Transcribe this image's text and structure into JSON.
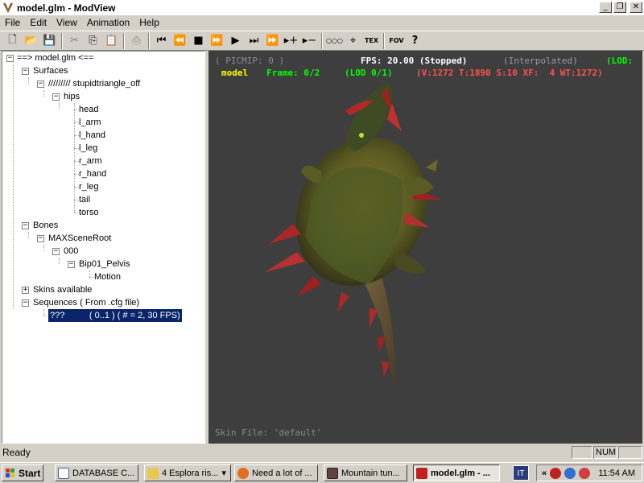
{
  "window": {
    "title": "model.glm - ModView",
    "min_glyph": "_",
    "max_glyph": "❐",
    "close_glyph": "✕"
  },
  "menu": [
    "File",
    "Edit",
    "View",
    "Animation",
    "Help"
  ],
  "toolbar": {
    "icons": [
      "new-file-icon",
      "open-folder-icon",
      "save-icon",
      "cut-icon",
      "copy-icon",
      "paste-icon",
      "print-icon",
      "rewind-icon",
      "step-back-icon",
      "stop-icon",
      "step-forward-icon",
      "play-icon",
      "play-end-icon",
      "fast-forward-icon",
      "add-icon",
      "remove-icon",
      "bones-icon",
      "fit-icon",
      "texture-icon",
      "fov-icon",
      "help-icon"
    ],
    "fov_label": "FOV",
    "tex_label": "TEX",
    "help_label": "?"
  },
  "tree": {
    "root": "==> model.glm <==",
    "surfaces": "Surfaces",
    "surface_root": "///////// stupidtriangle_off",
    "hips": "hips",
    "parts": [
      "head",
      "l_arm",
      "l_hand",
      "l_leg",
      "r_arm",
      "r_hand",
      "r_leg",
      "tail",
      "torso"
    ],
    "bones": "Bones",
    "max_root": "MAXSceneRoot",
    "bone_000": "000",
    "pelvis": "Bip01_Pelvis",
    "motion": "Motion",
    "skins": "Skins available",
    "sequences": "Sequences ( From .cfg file)",
    "sequence_item": "???          ( 0..1 ) ( # = 2, 30 FPS)"
  },
  "viewport": {
    "picmip": "( PICMIP: 0 )",
    "fps": "FPS: 20.00 (Stopped)",
    "interp": "(Interpolated)",
    "lod_top": "(LOD:",
    "model_label": "model",
    "frame": "Frame: 0/2",
    "lod": "(LOD 0/1)",
    "stats": "(V:1272 T:1890 S:10 XF:  4 WT:1272)",
    "skin_file": "Skin File: 'default'",
    "colors": {
      "hud_gray": "#9a9a9a",
      "hud_white": "#ffffff",
      "hud_yellow": "#ffff00",
      "hud_green": "#00ff00",
      "hud_red": "#ff5050"
    }
  },
  "status": {
    "ready": "Ready",
    "num": "NUM"
  },
  "taskbar": {
    "start": "Start",
    "tasks": [
      "DATABASE C...",
      "4 Esplora ris...",
      "Need a lot of ...",
      "Mountain tun...",
      "model.glm - ..."
    ],
    "lang": "IT",
    "clock": "11:54 AM",
    "tray_chevron": "«"
  }
}
